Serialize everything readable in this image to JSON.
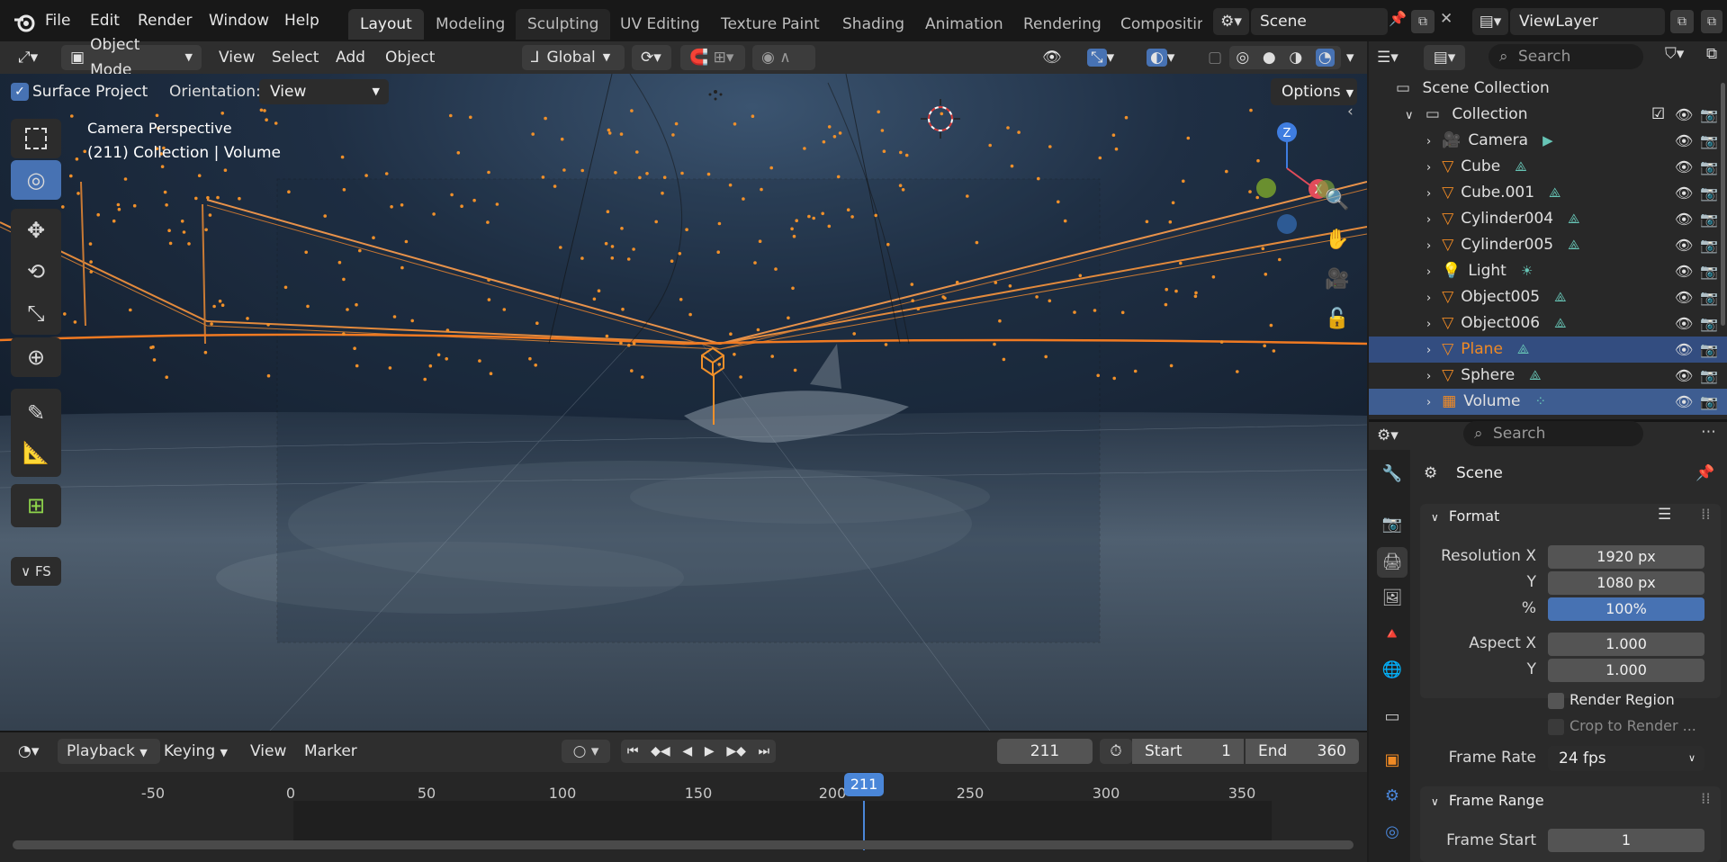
{
  "menu": [
    "File",
    "Edit",
    "Render",
    "Window",
    "Help"
  ],
  "workspaces": [
    "Layout",
    "Modeling",
    "Sculpting",
    "UV Editing",
    "Texture Paint",
    "Shading",
    "Animation",
    "Rendering",
    "Compositing"
  ],
  "scene_name": "Scene",
  "view_layer": "ViewLayer",
  "viewport_header": {
    "mode": "Object Mode",
    "items": [
      "View",
      "Select",
      "Add",
      "Object"
    ],
    "transform_orientation": "Global"
  },
  "tool_settings": {
    "surface_project": "Surface Project",
    "orientation_label": "Orientation:",
    "orientation_value": "View",
    "options": "Options"
  },
  "viewport_text": {
    "camera": "Camera Perspective",
    "collection": "(211) Collection | Volume"
  },
  "gizmo": {
    "z": "Z",
    "x": "X"
  },
  "tool_panel": "FS",
  "timeline": {
    "menus": [
      "Playback",
      "Keying",
      "View",
      "Marker"
    ],
    "current_frame": "211",
    "start_label": "Start",
    "start": "1",
    "end_label": "End",
    "end": "360",
    "ticks": [
      "-50",
      "0",
      "50",
      "100",
      "150",
      "200",
      "250",
      "300",
      "350"
    ],
    "playhead": "211"
  },
  "outliner": {
    "search_placeholder": "Search",
    "scene_collection": "Scene Collection",
    "collection": "Collection",
    "items": [
      {
        "name": "Camera",
        "type": "camera"
      },
      {
        "name": "Cube",
        "type": "mesh"
      },
      {
        "name": "Cube.001",
        "type": "mesh"
      },
      {
        "name": "Cylinder004",
        "type": "mesh"
      },
      {
        "name": "Cylinder005",
        "type": "mesh"
      },
      {
        "name": "Light",
        "type": "light"
      },
      {
        "name": "Object005",
        "type": "mesh"
      },
      {
        "name": "Object006",
        "type": "mesh"
      },
      {
        "name": "Plane",
        "type": "mesh"
      },
      {
        "name": "Sphere",
        "type": "mesh"
      },
      {
        "name": "Volume",
        "type": "volume"
      }
    ]
  },
  "properties": {
    "search_placeholder": "Search",
    "context": "Scene",
    "format_panel": "Format",
    "resolution_x_label": "Resolution X",
    "resolution_x": "1920 px",
    "y_label": "Y",
    "resolution_y": "1080 px",
    "pct_label": "%",
    "resolution_pct": "100%",
    "resolution_pct_value": 1.0,
    "aspect_x_label": "Aspect X",
    "aspect_x": "1.000",
    "aspect_y_label": "Y",
    "aspect_y": "1.000",
    "render_region": "Render Region",
    "crop": "Crop to Render ...",
    "frame_rate_label": "Frame Rate",
    "frame_rate": "24 fps",
    "frame_range_panel": "Frame Range",
    "frame_start_label": "Frame Start",
    "frame_start": "1"
  },
  "colors": {
    "accent_blue": "#4772b3",
    "selection_orange": "#f08a24",
    "playhead": "#4a86d8"
  }
}
